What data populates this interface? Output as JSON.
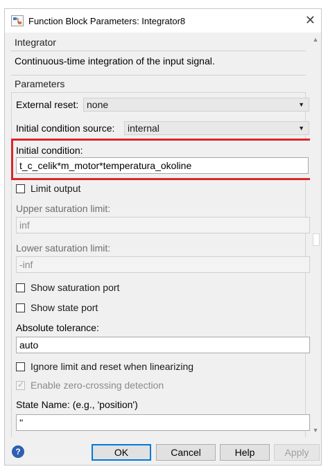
{
  "window": {
    "title": "Function Block Parameters: Integrator8",
    "close_glyph": "✕"
  },
  "block": {
    "name": "Integrator",
    "description": "Continuous-time integration of the input signal."
  },
  "parameters": {
    "section_label": "Parameters",
    "external_reset": {
      "label": "External reset:",
      "value": "none"
    },
    "initial_condition_source": {
      "label": "Initial condition source:",
      "value": "internal"
    },
    "initial_condition": {
      "label": "Initial condition:",
      "value": "t_c_celik*m_motor*temperatura_okoline"
    },
    "limit_output": {
      "label": "Limit output",
      "checked": false
    },
    "upper_saturation": {
      "label": "Upper saturation limit:",
      "value": "inf"
    },
    "lower_saturation": {
      "label": "Lower saturation limit:",
      "value": "-inf"
    },
    "show_saturation_port": {
      "label": "Show saturation port",
      "checked": false
    },
    "show_state_port": {
      "label": "Show state port",
      "checked": false
    },
    "absolute_tolerance": {
      "label": "Absolute tolerance:",
      "value": "auto"
    },
    "ignore_limit": {
      "label": "Ignore limit and reset when linearizing",
      "checked": false
    },
    "zero_crossing": {
      "label": "Enable zero-crossing detection",
      "checked": true
    },
    "state_name": {
      "label": "State Name: (e.g., 'position')",
      "value": "''"
    }
  },
  "buttons": {
    "ok": "OK",
    "cancel": "Cancel",
    "help": "Help",
    "apply": "Apply"
  },
  "colors": {
    "highlight": "#d9262c",
    "dialog_bg": "#f0f0f0",
    "default_button_border": "#0078d7"
  }
}
